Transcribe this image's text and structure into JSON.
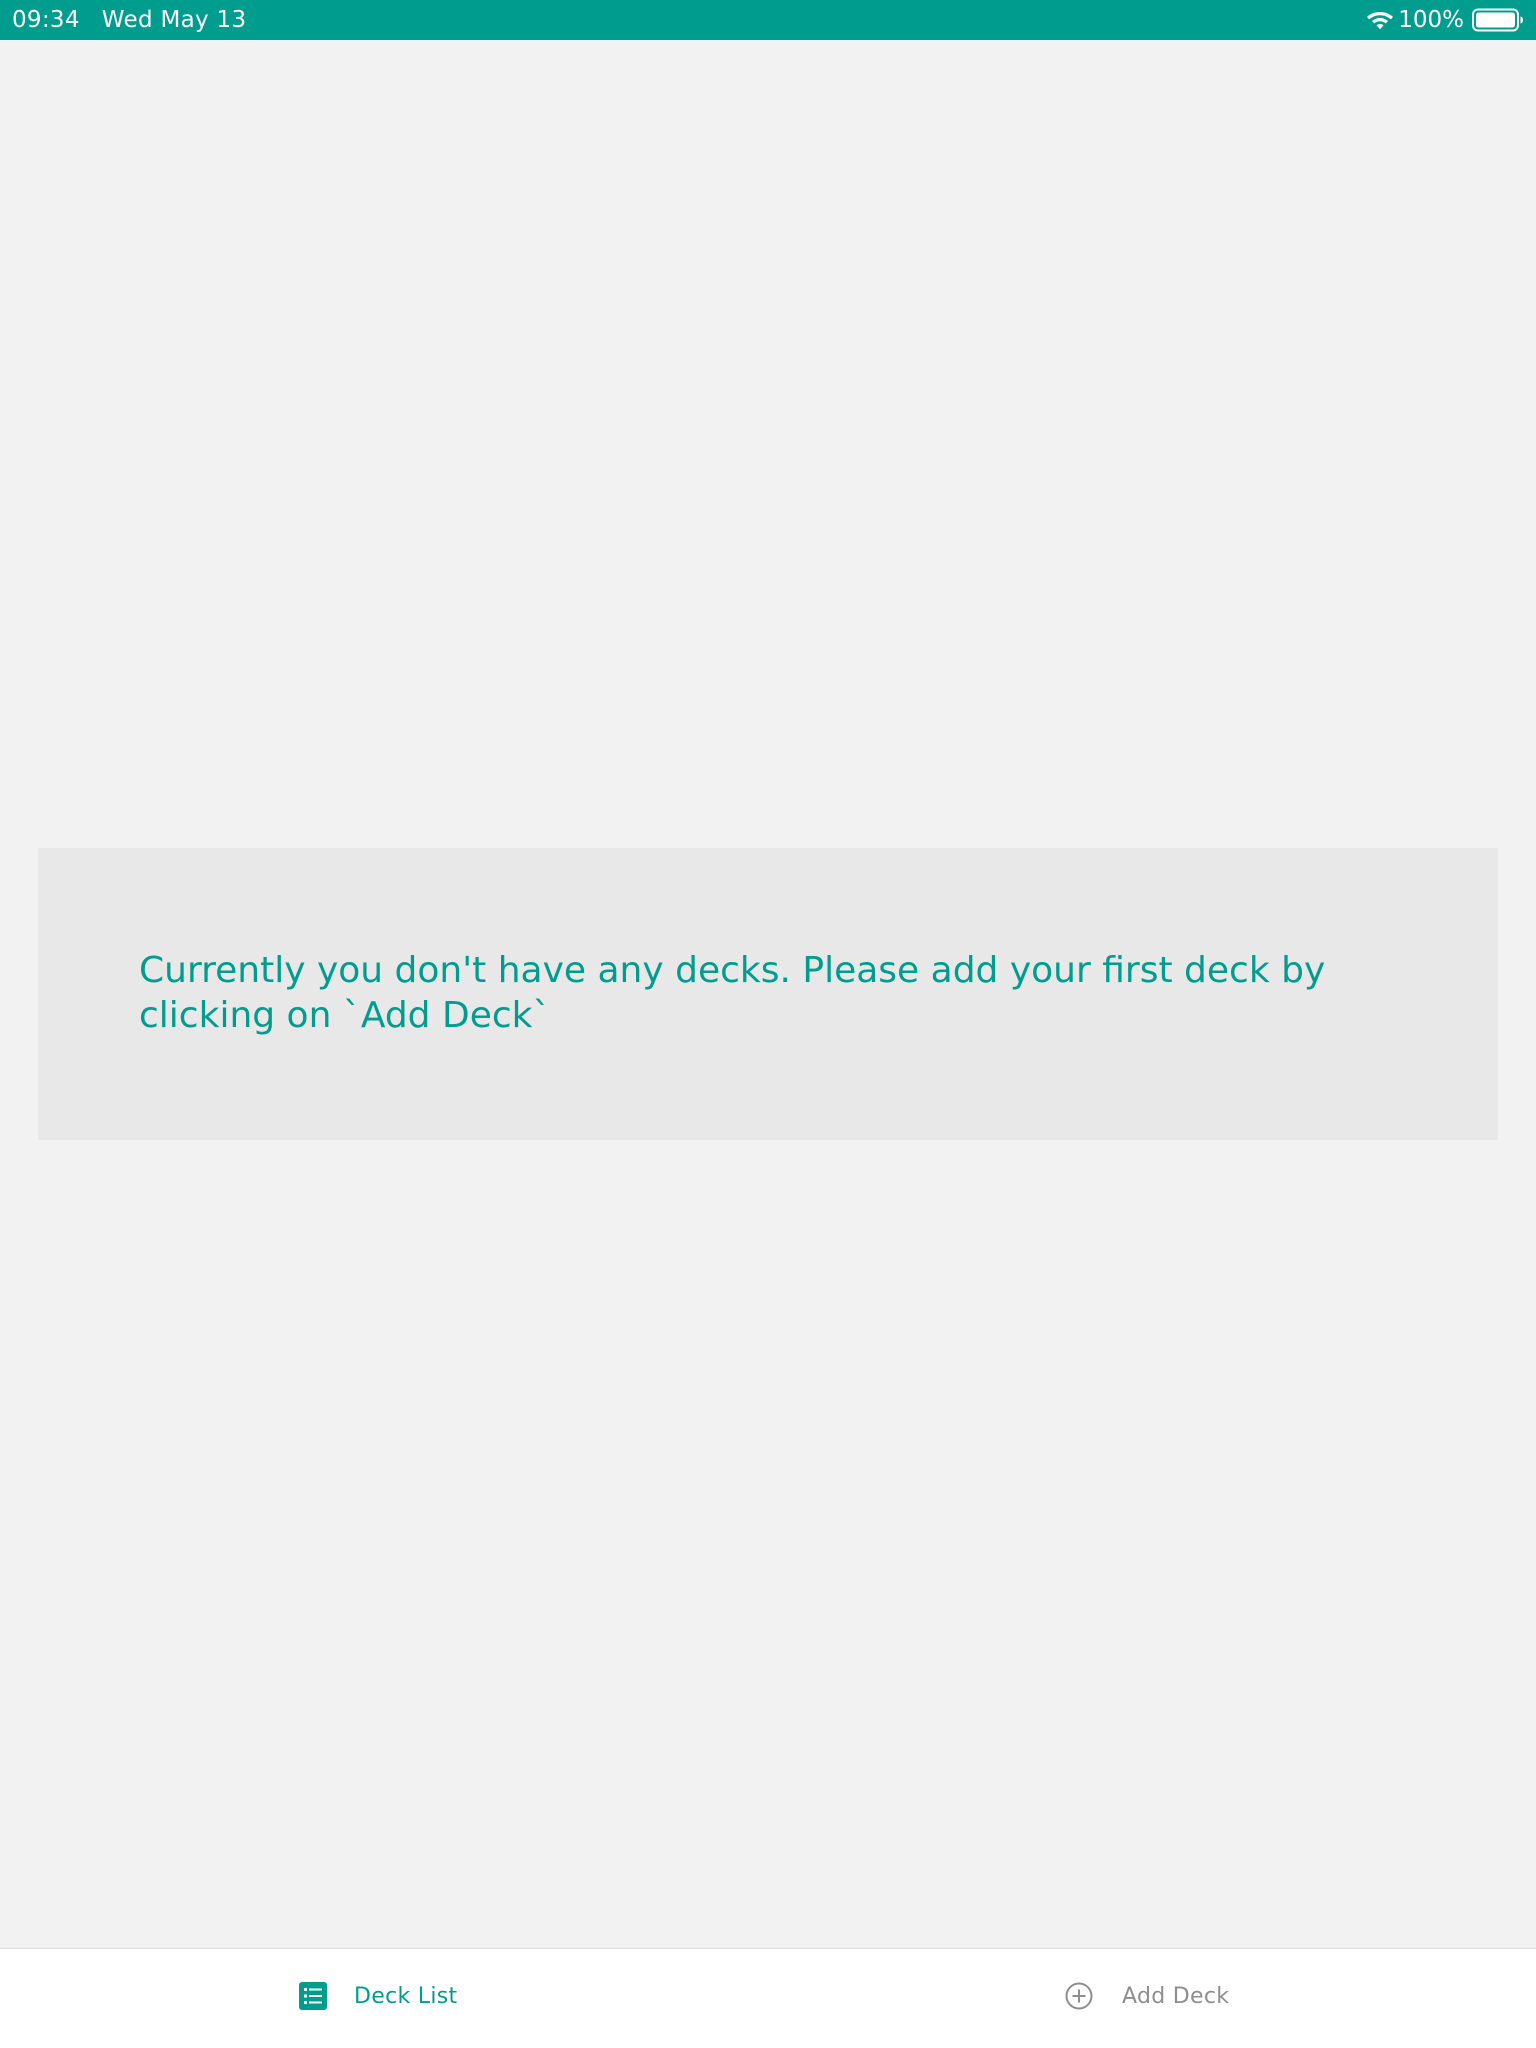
{
  "status_bar": {
    "time": "09:34",
    "date": "Wed May 13",
    "battery_percent": "100%",
    "wifi_icon": "wifi-icon",
    "battery_icon": "battery-full-icon"
  },
  "colors": {
    "accent": "#009d8f",
    "background": "#f2f2f2",
    "card_background": "#e8e8e8",
    "tab_inactive": "#8e8e8e",
    "tab_bar_background": "#ffffff"
  },
  "main": {
    "empty_message": "Currently you don't have any decks. Please add your first deck by clicking on `Add Deck`"
  },
  "tab_bar": {
    "items": [
      {
        "label": "Deck List",
        "icon": "list-icon",
        "active": true
      },
      {
        "label": "Add Deck",
        "icon": "plus-circle-icon",
        "active": false
      }
    ]
  }
}
